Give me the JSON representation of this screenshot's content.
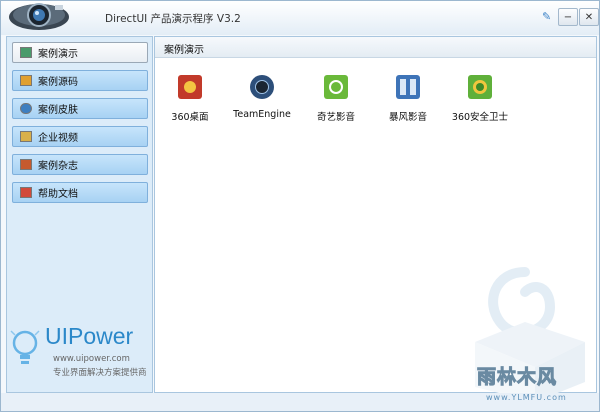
{
  "window": {
    "title": "DirectUI 产品演示程序 V3.2",
    "minimize_glyph": "−",
    "close_glyph": "✕",
    "pin_glyph": "✎"
  },
  "sidebar": {
    "items": [
      {
        "label": "案例演示",
        "icon": "monitor-icon",
        "color": "#4a9b6b",
        "active": true
      },
      {
        "label": "案例源码",
        "icon": "code-icon",
        "color": "#e0a030",
        "active": false
      },
      {
        "label": "案例皮肤",
        "icon": "palette-icon",
        "color": "#3e7fc0",
        "active": false
      },
      {
        "label": "企业视频",
        "icon": "video-icon",
        "color": "#d9b04a",
        "active": false
      },
      {
        "label": "案例杂志",
        "icon": "magazine-icon",
        "color": "#c65a2e",
        "active": false
      },
      {
        "label": "帮助文档",
        "icon": "help-icon",
        "color": "#d24a3a",
        "active": false
      }
    ]
  },
  "brand": {
    "name": "UIPower",
    "url": "www.uipower.com",
    "tagline": "专业界面解决方案提供商"
  },
  "content": {
    "title": "案例演示",
    "apps": [
      {
        "label": "360桌面",
        "icon": "360-desktop-icon",
        "color": "#c23a2a"
      },
      {
        "label": "TeamEngine",
        "icon": "teamengine-icon",
        "color": "#2d4f7a"
      },
      {
        "label": "奇艺影音",
        "icon": "qiyi-icon",
        "color": "#6ab93a"
      },
      {
        "label": "暴风影音",
        "icon": "baofeng-icon",
        "color": "#3e74b8"
      },
      {
        "label": "360安全卫士",
        "icon": "360-safe-icon",
        "color": "#5fb03a"
      }
    ]
  },
  "watermark": {
    "text": "雨林木风",
    "url": "www.YLMFU.com"
  }
}
